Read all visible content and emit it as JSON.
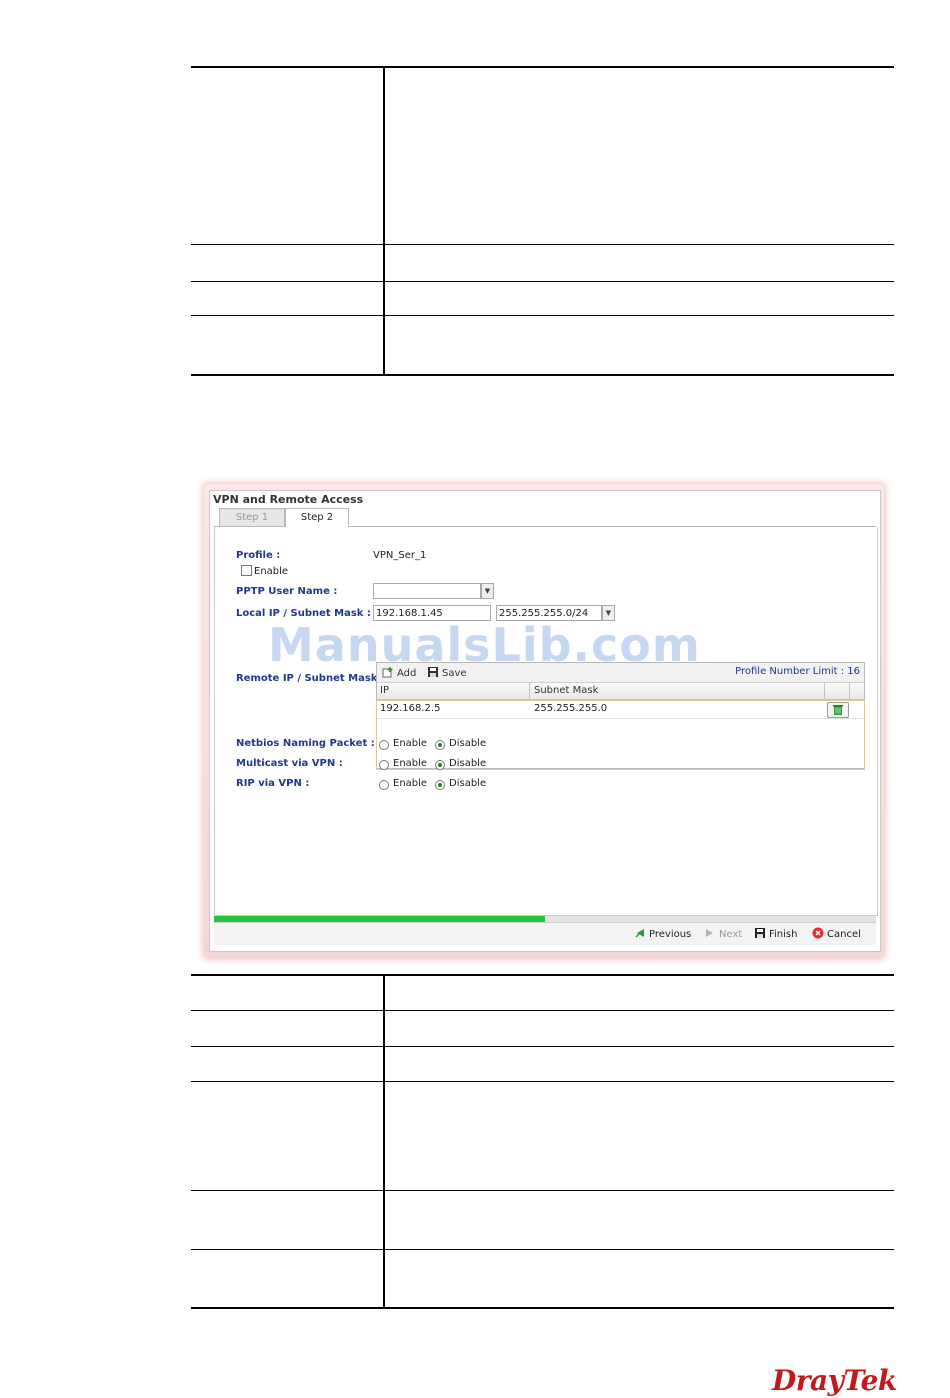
{
  "panel": {
    "title": "VPN and Remote Access",
    "tabs": [
      {
        "label": "Step 1",
        "active": false
      },
      {
        "label": "Step 2",
        "active": true
      }
    ]
  },
  "form": {
    "profile_label": "Profile :",
    "profile_value": "VPN_Ser_1",
    "enable_label": "Enable",
    "enable_checked": false,
    "pptp_user_label": "PPTP User Name :",
    "pptp_user_value": "",
    "local_ip_label": "Local IP / Subnet Mask :",
    "local_ip_value": "192.168.1.45",
    "local_mask_value": "255.255.255.0/24",
    "remote_ip_label": "Remote IP / Subnet Mask :"
  },
  "grid": {
    "add_label": "Add",
    "save_label": "Save",
    "limit_text": "Profile Number Limit : 16",
    "columns": [
      "IP",
      "Subnet Mask"
    ],
    "rows": [
      {
        "ip": "192.168.2.5",
        "mask": "255.255.255.0"
      }
    ]
  },
  "options": [
    {
      "label": "Netbios Naming Packet :",
      "enable": "Enable",
      "disable": "Disable",
      "selected": "Disable"
    },
    {
      "label": "Multicast via VPN :",
      "enable": "Enable",
      "disable": "Disable",
      "selected": "Disable"
    },
    {
      "label": "RIP via VPN :",
      "enable": "Enable",
      "disable": "Disable",
      "selected": "Disable"
    }
  ],
  "progress": {
    "fraction": 0.5
  },
  "footer": {
    "previous": "Previous",
    "next": "Next",
    "finish": "Finish",
    "cancel": "Cancel"
  },
  "watermark": "ManualsLib.com",
  "brand": {
    "logo": "DrayTek",
    "color": "#c4191a",
    "accent": "#1e3a8a",
    "progress_color": "#23c33a"
  }
}
